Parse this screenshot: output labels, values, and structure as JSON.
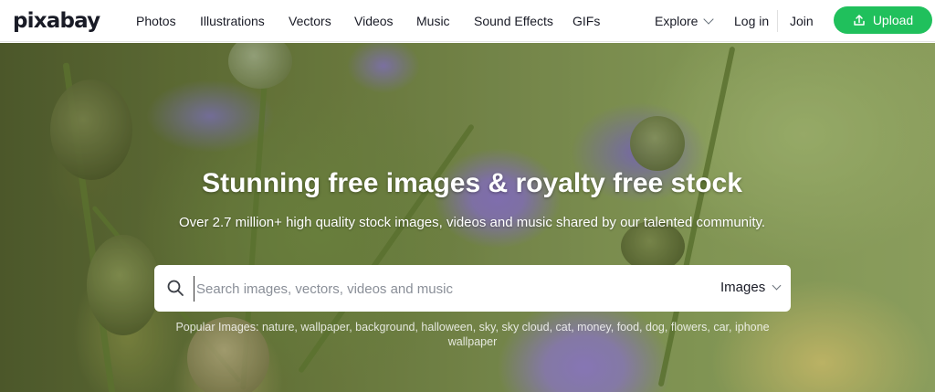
{
  "brand": {
    "logo_text": "pixabay"
  },
  "nav": {
    "items": [
      {
        "label": "Photos"
      },
      {
        "label": "Illustrations"
      },
      {
        "label": "Vectors"
      },
      {
        "label": "Videos"
      },
      {
        "label": "Music"
      },
      {
        "label": "Sound Effects"
      },
      {
        "label": "GIFs"
      }
    ],
    "explore_label": "Explore",
    "login_label": "Log in",
    "join_label": "Join",
    "upload_label": "Upload"
  },
  "hero": {
    "title": "Stunning free images & royalty free stock",
    "subtitle": "Over 2.7 million+ high quality stock images, videos and music shared by our talented community.",
    "search": {
      "placeholder": "Search images, vectors, videos and music",
      "value": "",
      "type_selected": "Images"
    },
    "popular_prefix": "Popular Images:",
    "popular_terms": [
      "nature",
      "wallpaper",
      "background",
      "halloween",
      "sky",
      "sky cloud",
      "cat",
      "money",
      "food",
      "dog",
      "flowers",
      "car",
      "iphone wallpaper"
    ]
  },
  "colors": {
    "accent": "#20c05c",
    "text_dark": "#191b26"
  },
  "icons": {
    "search": "search-icon",
    "upload": "upload-icon",
    "chevron": "chevron-down-icon"
  }
}
